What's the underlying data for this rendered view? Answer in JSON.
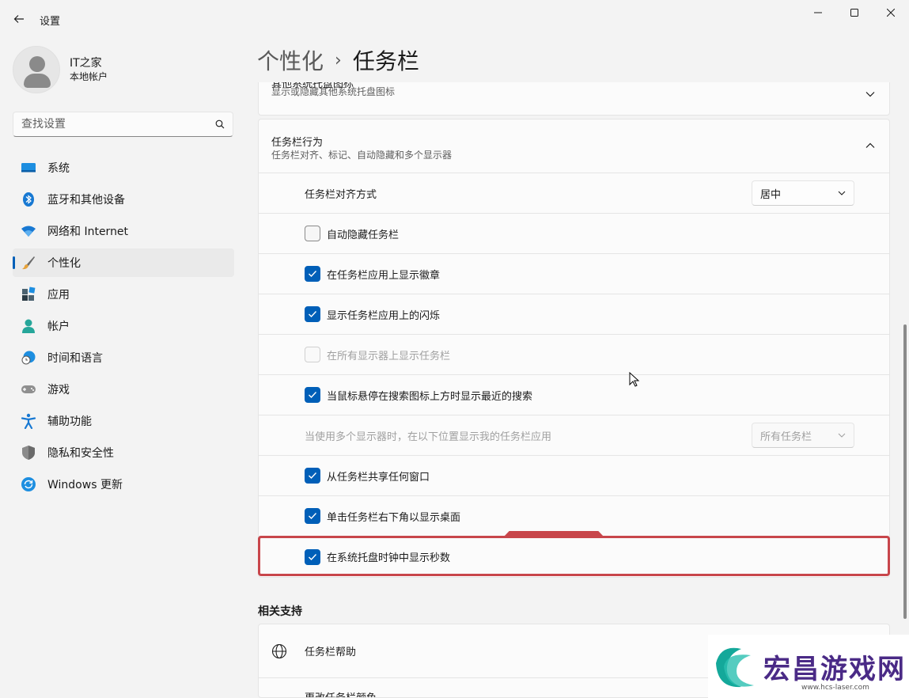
{
  "window": {
    "app_title": "设置"
  },
  "profile": {
    "name": "IT之家",
    "account_type": "本地帐户"
  },
  "search": {
    "placeholder": "查找设置"
  },
  "nav": {
    "items": [
      {
        "label": "系统",
        "icon": "system-icon"
      },
      {
        "label": "蓝牙和其他设备",
        "icon": "bluetooth-icon"
      },
      {
        "label": "网络和 Internet",
        "icon": "wifi-icon"
      },
      {
        "label": "个性化",
        "icon": "brush-icon",
        "active": true
      },
      {
        "label": "应用",
        "icon": "apps-icon"
      },
      {
        "label": "帐户",
        "icon": "person-icon"
      },
      {
        "label": "时间和语言",
        "icon": "globe-clock-icon"
      },
      {
        "label": "游戏",
        "icon": "gamepad-icon"
      },
      {
        "label": "辅助功能",
        "icon": "accessibility-icon"
      },
      {
        "label": "隐私和安全性",
        "icon": "shield-icon"
      },
      {
        "label": "Windows 更新",
        "icon": "update-icon"
      }
    ]
  },
  "breadcrumb": {
    "parent": "个性化",
    "separator": "›",
    "current": "任务栏"
  },
  "tray_card": {
    "title": "其他系统托盘图标",
    "subtitle": "显示或隐藏其他系统托盘图标"
  },
  "behavior": {
    "title": "任务栏行为",
    "subtitle": "任务栏对齐、标记、自动隐藏和多个显示器",
    "alignment_label": "任务栏对齐方式",
    "alignment_value": "居中",
    "options": [
      {
        "label": "自动隐藏任务栏",
        "state": "unchecked"
      },
      {
        "label": "在任务栏应用上显示徽章",
        "state": "checked"
      },
      {
        "label": "显示任务栏应用上的闪烁",
        "state": "checked"
      },
      {
        "label": "在所有显示器上显示任务栏",
        "state": "disabled"
      },
      {
        "label": "当鼠标悬停在搜索图标上方时显示最近的搜索",
        "state": "checked"
      }
    ],
    "multi_display_label": "当使用多个显示器时，在以下位置显示我的任务栏应用",
    "multi_display_value": "所有任务栏",
    "options2": [
      {
        "label": "从任务栏共享任何窗口",
        "state": "checked"
      },
      {
        "label": "单击任务栏右下角以显示桌面",
        "state": "checked"
      },
      {
        "label": "在系统托盘时钟中显示秒数",
        "state": "checked"
      }
    ]
  },
  "related": {
    "title": "相关支持",
    "help_label": "任务栏帮助",
    "next_label": "更改任务栏颜色"
  },
  "watermark": {
    "text": "宏昌游戏网",
    "url": "www.hcs-laser.com"
  },
  "colors": {
    "accent": "#005fb8",
    "highlight": "#c8464b"
  }
}
